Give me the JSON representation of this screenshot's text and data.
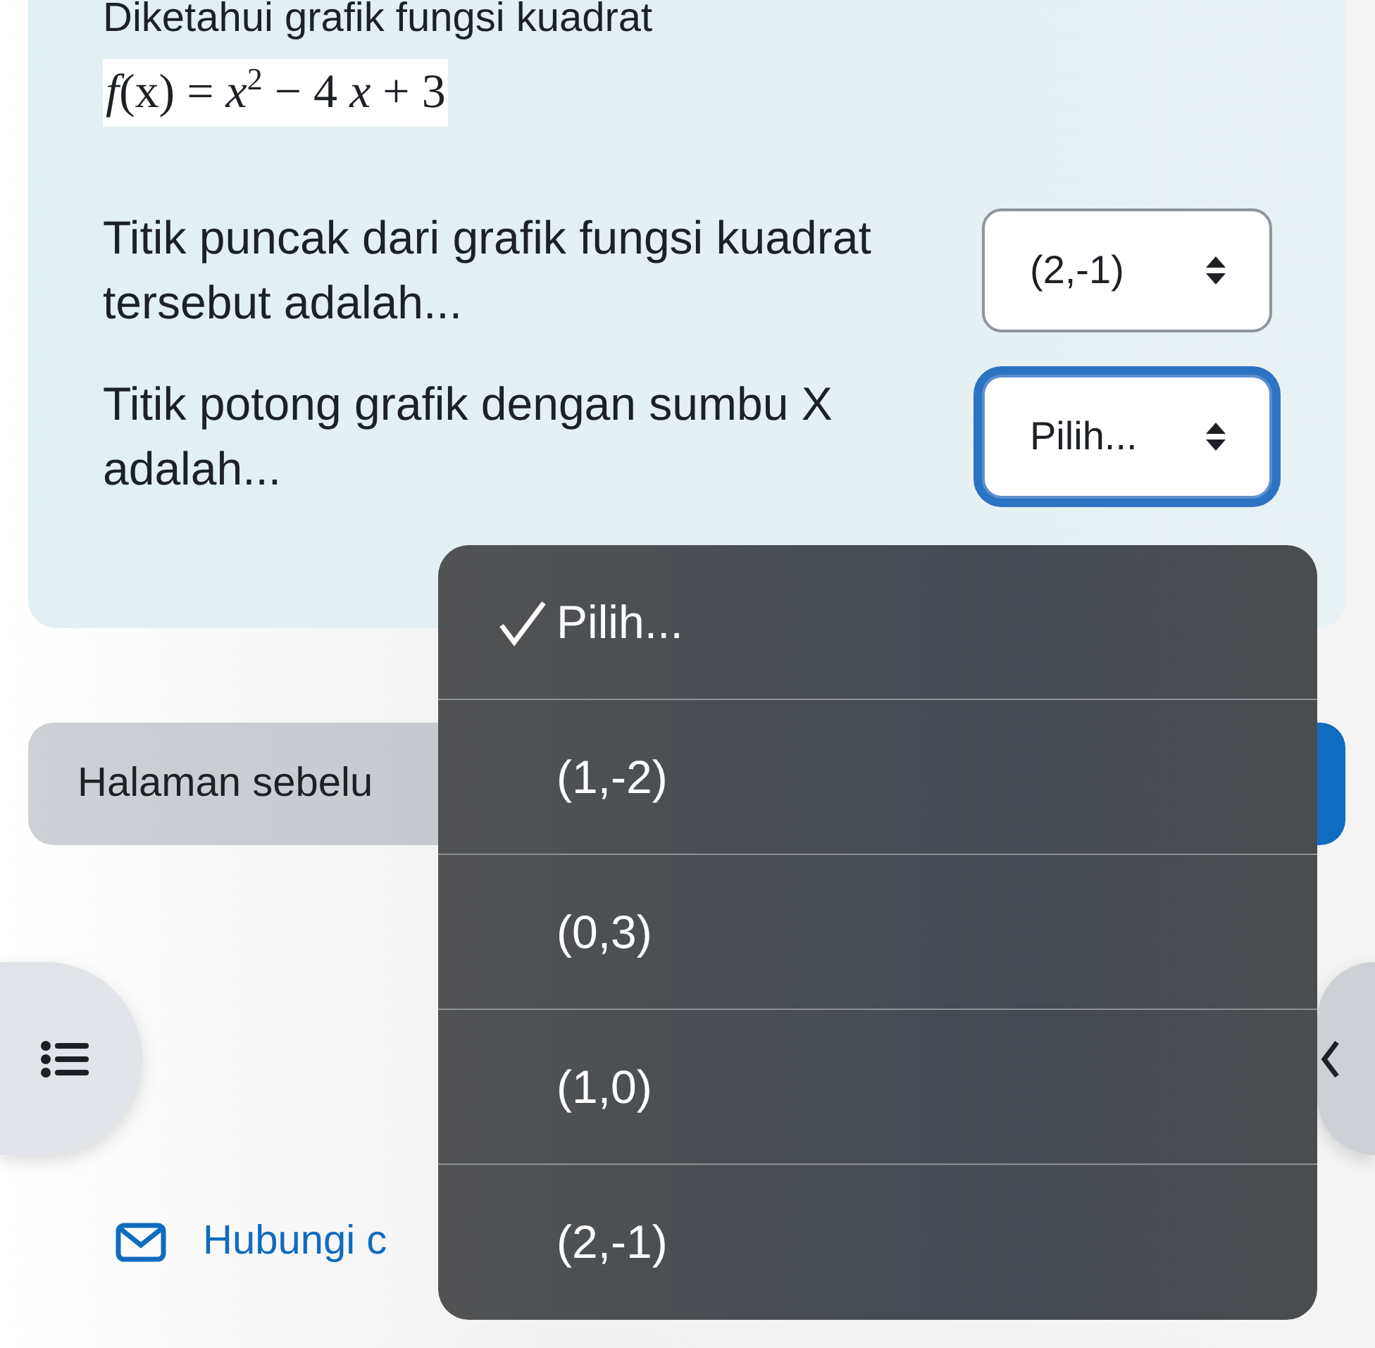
{
  "question": {
    "intro": "Diketahui grafik fungsi kuadrat",
    "formula": "*f*(x) = *x*$^{2}$ − 4 *x* + 3",
    "items": [
      {
        "prompt": "Titik puncak dari grafik fungsi kuadrat tersebut adalah...",
        "value": "(2,-1)",
        "focused": false
      },
      {
        "prompt": "Titik potong grafik dengan sumbu X adalah...",
        "value": "Pilih...",
        "focused": true
      }
    ]
  },
  "navigation": {
    "previous": "Halaman sebelu"
  },
  "footer_link": "Hubungi c",
  "dropdown": {
    "options": [
      {
        "label": "Pilih...",
        "selected": true
      },
      {
        "label": "(1,-2)",
        "selected": false
      },
      {
        "label": "(0,3)",
        "selected": false
      },
      {
        "label": "(1,0)",
        "selected": false
      },
      {
        "label": "(2,-1)",
        "selected": false
      }
    ]
  }
}
